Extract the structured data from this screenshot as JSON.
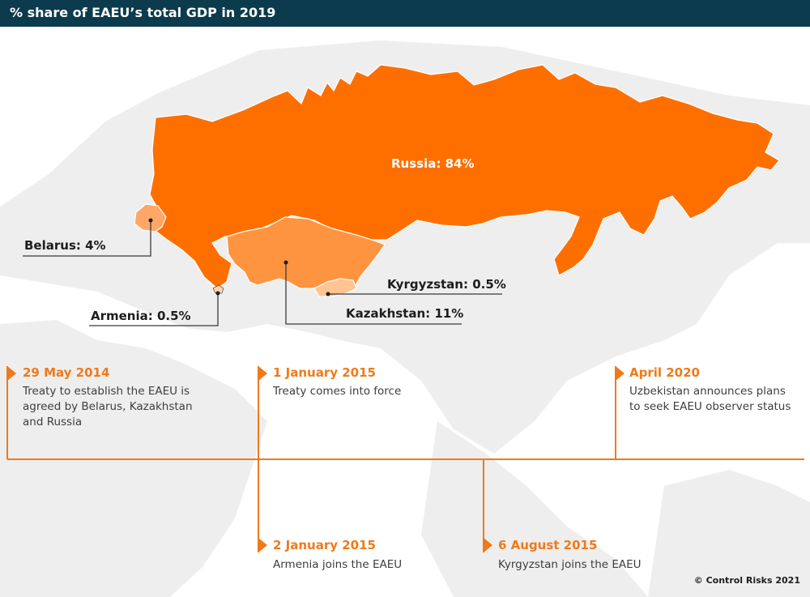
{
  "title": "% share of EAEU’s total GDP in 2019",
  "colors": {
    "title_bar": "#0c3b4d",
    "russia": "#ff6f00",
    "kazakhstan": "#ff9440",
    "belarus": "#ffa766",
    "kyrgyzstan": "#ffc491",
    "armenia": "#ffd2ad",
    "accent": "#f07a1a",
    "land_background": "#eeeeee"
  },
  "countries": [
    {
      "id": "russia",
      "label": "Russia: 84%",
      "share": 84
    },
    {
      "id": "belarus",
      "label": "Belarus: 4%",
      "share": 4
    },
    {
      "id": "kazakhstan",
      "label": "Kazakhstan: 11%",
      "share": 11
    },
    {
      "id": "kyrgyzstan",
      "label": "Kyrgyzstan: 0.5%",
      "share": 0.5
    },
    {
      "id": "armenia",
      "label": "Armenia: 0.5%",
      "share": 0.5
    }
  ],
  "timeline": [
    {
      "date": "29 May 2014",
      "text": [
        "Treaty to establish the EAEU is",
        "agreed by Belarus, Kazakhstan",
        "and Russia"
      ],
      "side": "above"
    },
    {
      "date": "1 January 2015",
      "text": [
        "Treaty comes into force"
      ],
      "side": "above"
    },
    {
      "date": "April 2020",
      "text": [
        "Uzbekistan announces plans",
        "to seek EAEU observer status"
      ],
      "side": "above"
    },
    {
      "date": "2 January 2015",
      "text": [
        "Armenia joins the EAEU"
      ],
      "side": "below"
    },
    {
      "date": "6 August 2015",
      "text": [
        "Kyrgyzstan joins the EAEU"
      ],
      "side": "below"
    }
  ],
  "credit": "© Control Risks 2021"
}
